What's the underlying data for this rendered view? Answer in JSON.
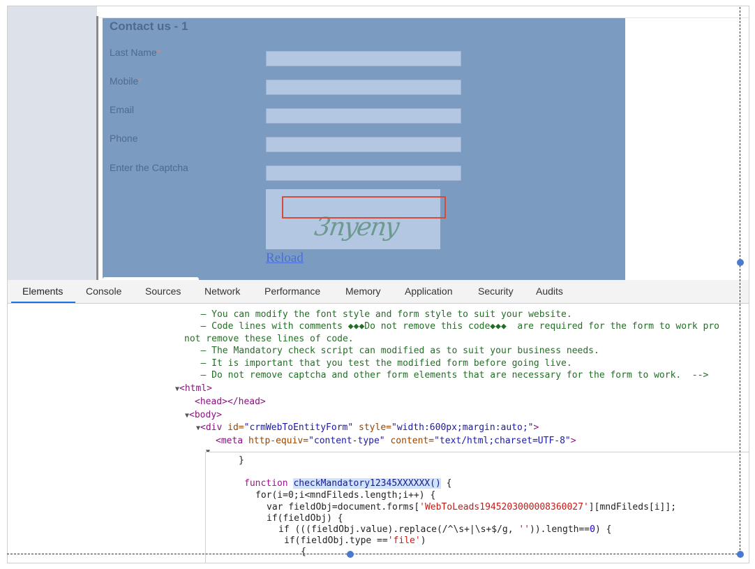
{
  "form": {
    "title": "Contact us - 1",
    "fields": [
      {
        "label": "Last Name",
        "required": "*"
      },
      {
        "label": "Mobile",
        "required": "*"
      },
      {
        "label": "Email",
        "required": ""
      },
      {
        "label": "Phone",
        "required": ""
      },
      {
        "label": "Enter the Captcha",
        "required": ""
      }
    ],
    "captcha_text": "3nyeny",
    "reload_label": "Reload"
  },
  "devtools": {
    "tabs": [
      "Elements",
      "Console",
      "Sources",
      "Network",
      "Performance",
      "Memory",
      "Application",
      "Security",
      "Audits"
    ],
    "active_tab": "Elements",
    "comments": [
      "   – You can modify the font style and form style to suit your website.",
      "   – Code lines with comments ◆◆◆Do not remove this code◆◆◆  are required for the form to work pro",
      "not remove these lines of code.",
      "   – The Mandatory check script can modified as to suit your business needs.",
      "   – It is important that you test the modified form before going live.",
      "   – Do not remove captcha and other form elements that are necessary for the form to work.  -->"
    ],
    "html_tag": "<html>",
    "head_tag": "<head></head>",
    "body_tag": "<body>",
    "div_open": "<div ",
    "div_id_attr": "id=",
    "div_id_val": "\"crmWebToEntityForm\"",
    "div_style_attr": " style=",
    "div_style_val": "\"width:600px;margin:auto;\"",
    "div_close": ">",
    "meta_open": "<meta ",
    "meta_equiv_attr": "http-equiv=",
    "meta_equiv_val": "\"content-type\"",
    "meta_content_attr": " content=",
    "meta_content_val": "\"text/html;charset=UTF-8\"",
    "meta_close": ">",
    "code": {
      "brace": "}",
      "function_kw": "function ",
      "function_name": "checkMandatory12345XXXXXX()",
      "function_brace": " {",
      "for_line": "for(i=0;i<mndFileds.length;i++) {",
      "var_line_a": "var fieldObj=document.forms[",
      "var_line_str": "'WebToLeads1945203000008360027'",
      "var_line_b": "][mndFileds[i]];",
      "if_line": "if(fieldObj) {",
      "if2_a": "if (((fieldObj.value).replace(/^\\s+|\\s+$/g, ",
      "if2_str": "''",
      "if2_b": ")).length==",
      "if2_num": "0",
      "if2_c": ") {",
      "if3_a": "if(fieldObj.type ==",
      "if3_str": "'file'",
      "if3_b": ")",
      "open_brace": "{"
    }
  },
  "colors": {
    "form_bg": "#7b9bc1",
    "input_bg": "#b4c7e2",
    "highlight_box": "#d44b3a",
    "tab_underline": "#1a73e8"
  }
}
